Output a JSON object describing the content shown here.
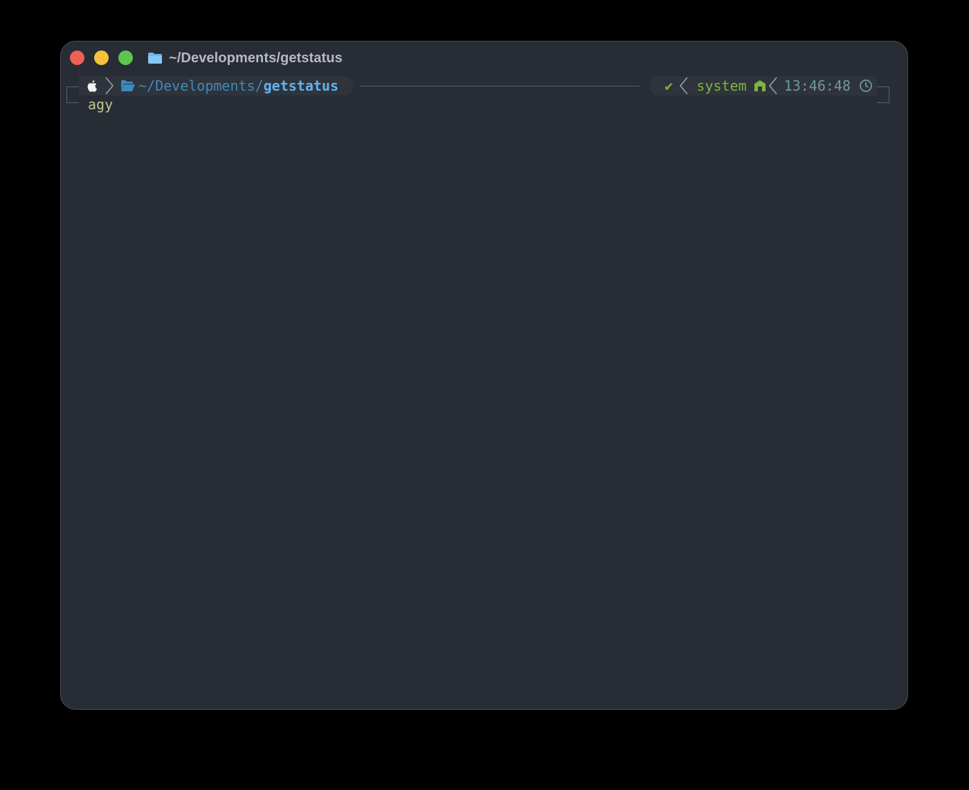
{
  "window": {
    "title": "~/Developments/getstatus",
    "colors": {
      "background": "#282c35",
      "close": "#ee5f58",
      "minimize": "#f6c23a",
      "zoom": "#5ec54d"
    }
  },
  "prompt": {
    "os_icon": "apple-icon",
    "folder_icon": "folder-open-icon",
    "path_prefix": "~/Developments/",
    "path_current": "getstatus",
    "status_symbol": "✔",
    "node_env": "system",
    "node_icon": "node-icon",
    "time": "13:46:48",
    "clock_icon": "clock-icon"
  },
  "terminal": {
    "command": "agy"
  }
}
